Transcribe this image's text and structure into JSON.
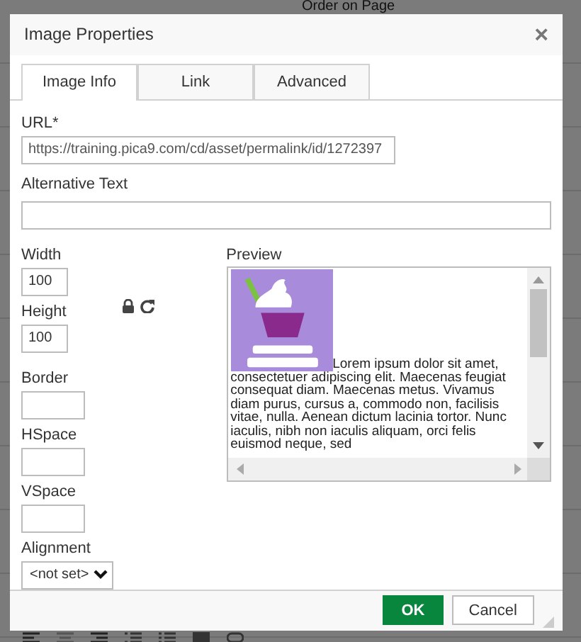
{
  "backdrop": {
    "heading": "Order on Page"
  },
  "window": {
    "title": "Image Properties",
    "close": "×"
  },
  "tabs": [
    {
      "label": "Image Info",
      "selected": true
    },
    {
      "label": "Link",
      "selected": false
    },
    {
      "label": "Advanced",
      "selected": false
    }
  ],
  "url": {
    "label": "URL*",
    "value": "https://training.pica9.com/cd/asset/permalink/id/1272397"
  },
  "alt_text": {
    "label": "Alternative Text"
  },
  "width": {
    "label": "Width",
    "value": "100"
  },
  "height": {
    "label": "Height",
    "value": "100"
  },
  "border": {
    "label": "Border"
  },
  "hspace": {
    "label": "HSpace"
  },
  "vspace": {
    "label": "VSpace"
  },
  "alignment": {
    "label": "Alignment",
    "value": "<not set>"
  },
  "preview": {
    "label": "Preview",
    "text": "Lorem ipsum dolor sit amet, consectetuer adipiscing elit. Maecenas feugiat consequat diam. Maecenas metus. Vivamus diam purus, cursus a, commodo non, facilisis vitae, nulla. Aenean dictum lacinia tortor. Nunc iaculis, nibh non iaculis aliquam, orci felis euismod neque, sed"
  },
  "buttons": [
    {
      "label": "OK",
      "kind": "primary"
    },
    {
      "label": "Cancel",
      "kind": "secondary"
    }
  ]
}
